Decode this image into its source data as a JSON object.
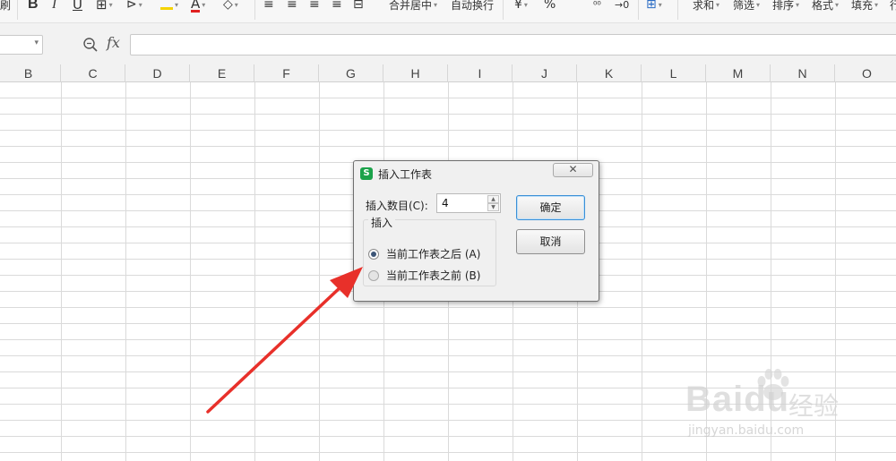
{
  "toolbar": {
    "items": [
      "刷",
      "B",
      "I",
      "U",
      "⊞",
      "⊳",
      "A",
      "A",
      "◇",
      "≡",
      "≡",
      "≡",
      "≡",
      "⊟",
      "合并居中",
      "自动换行",
      "¥",
      "%",
      "⁰⁰",
      "→0",
      "⊞",
      "求和",
      "筛选",
      "排序",
      "格式",
      "填充",
      "行"
    ]
  },
  "formula_bar": {
    "fx_label": "fx",
    "value": ""
  },
  "columns": [
    "B",
    "C",
    "D",
    "E",
    "F",
    "G",
    "H",
    "I",
    "J",
    "K",
    "L",
    "M",
    "N",
    "O"
  ],
  "dialog": {
    "logo": "S",
    "title": "插入工作表",
    "close": "✕",
    "count_label": "插入数目(C):",
    "count_value": "4",
    "group_label": "插入",
    "option_after": "当前工作表之后 (A)",
    "option_before": "当前工作表之前 (B)",
    "selected": "after",
    "ok": "确定",
    "cancel": "取消"
  },
  "annotation": {
    "arrow_color": "#e8302a"
  },
  "watermark": {
    "brand": "Baidu",
    "cn": "经验",
    "url": "jingyan.baidu.com"
  }
}
